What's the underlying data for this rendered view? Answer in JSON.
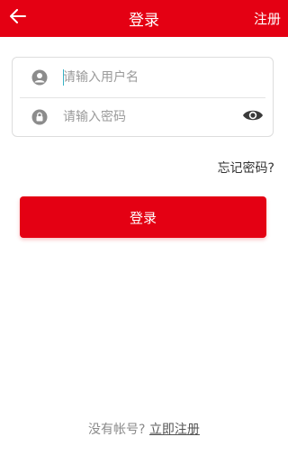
{
  "header": {
    "title": "登录",
    "register_label": "注册",
    "bg_color": "#e40013"
  },
  "form": {
    "username": {
      "placeholder": "请输入用户名",
      "value": "",
      "icon": "user-icon"
    },
    "password": {
      "placeholder": "请输入密码",
      "value": "",
      "icon": "lock-icon",
      "toggle_icon": "eye-icon"
    }
  },
  "forgot_label": "忘记密码?",
  "login_button_label": "登录",
  "footer": {
    "prompt": "没有帐号?",
    "register_link": "立即注册"
  },
  "colors": {
    "accent": "#e40013",
    "icon_gray": "#8c8c8c"
  }
}
